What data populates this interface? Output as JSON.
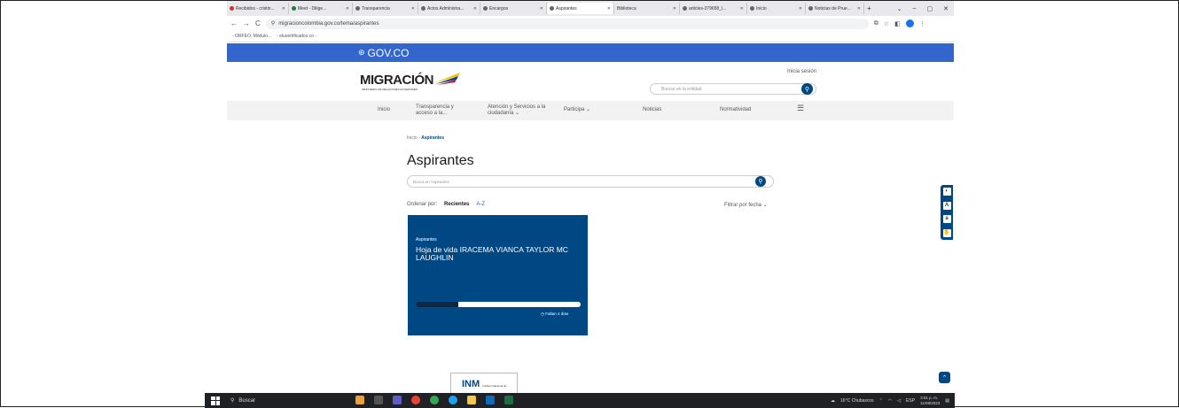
{
  "tabs": [
    {
      "label": "Recibidos - cristin..."
    },
    {
      "label": "Meet - Dilige..."
    },
    {
      "label": "Transparencia"
    },
    {
      "label": "Actos Administra..."
    },
    {
      "label": "Encargos"
    },
    {
      "label": "Aspirantes",
      "active": true
    },
    {
      "label": "Biblioteca"
    },
    {
      "label": "articles-379658_l..."
    },
    {
      "label": "Inicio"
    },
    {
      "label": "Noticias de Prue..."
    }
  ],
  "address": {
    "url": "migracioncolombia.gov.co/tema/aspirantes"
  },
  "bookmarks": [
    "- ORFEO. Módulo...",
    "- eluvertificados.co -"
  ],
  "gov": {
    "label": "GOV.CO"
  },
  "header": {
    "logo": "MIGRACIÓN",
    "logo_sub": "MINISTERIO DE RELACIONES EXTERIORES",
    "login": "Inicia sesión",
    "search_placeholder": "Buscar en la entidad"
  },
  "nav": {
    "inicio": "Inicio",
    "transparencia": "Transparencia y acceso a la...",
    "atencion": "Atención y Servicios a la ciudadanía ⌄",
    "participa": "Participa ⌄",
    "noticias": "Noticias",
    "normatividad": "Normatividad",
    "menu": "☰"
  },
  "breadcrumb": {
    "home": "Inicio",
    "sep": "›",
    "current": "Aspirantes"
  },
  "page": {
    "title": "Aspirantes",
    "search_placeholder": "Busca en Aspirantes",
    "order_label": "Ordenar por:",
    "order_recent": "Recientes",
    "order_az": "A-Z",
    "filter": "Filtrar por fecha ⌄"
  },
  "card": {
    "category": "Aspirantes",
    "title": "Hoja de vida IRACEMA VIANCA TAYLOR MC LAUGHLIN",
    "remaining": "Faltan 4 días",
    "progress_fraction": 0.26
  },
  "footer": {
    "logo": "INM",
    "logo_sub": "Instituto Nacional de Metrología de Colombia"
  },
  "taskbar": {
    "search": "Buscar",
    "weather": "16°C Chubascos",
    "lang": "ESP",
    "time": "3:01 p. m.",
    "date": "11/08/2023"
  },
  "colors": {
    "primary": "#004884",
    "gov_blue": "#3366cc"
  }
}
